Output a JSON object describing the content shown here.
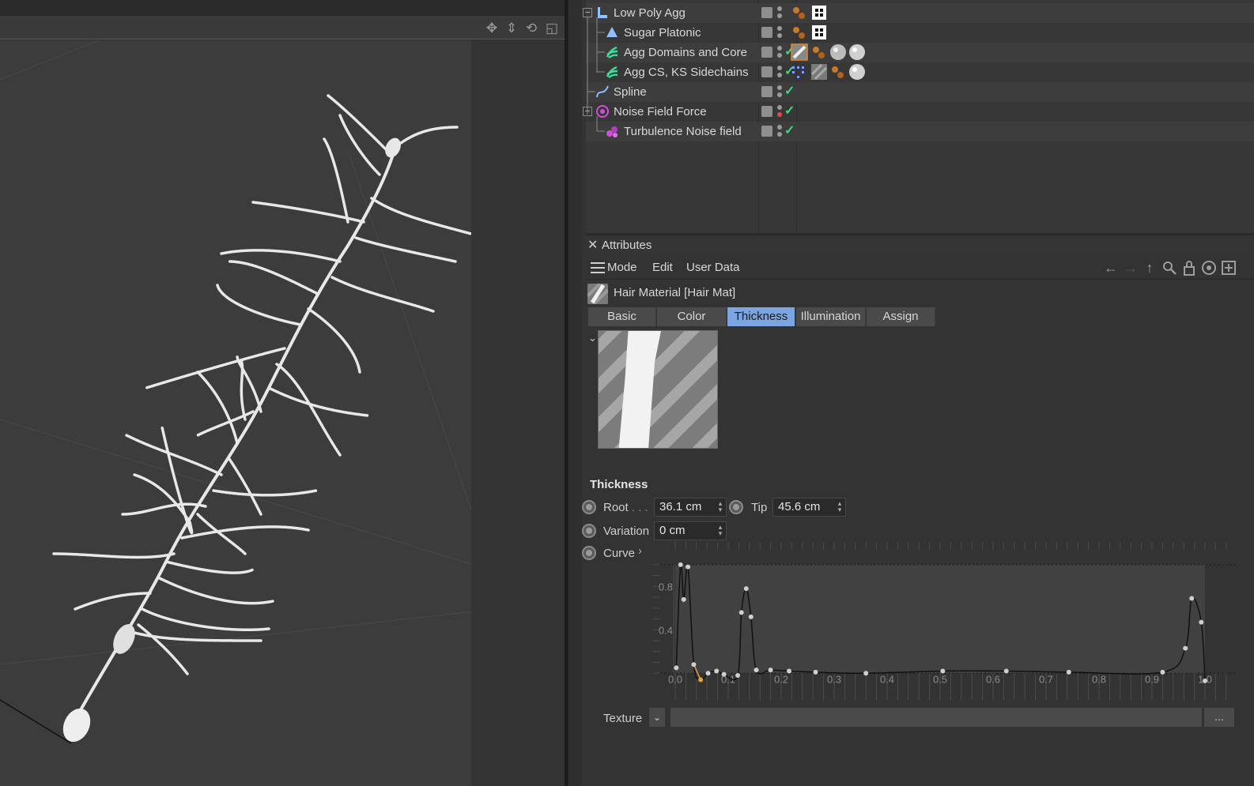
{
  "object_manager": {
    "objects": [
      {
        "name": "Low Poly Agg",
        "icon": "null-object-icon",
        "expander": "−"
      },
      {
        "name": "Sugar Platonic",
        "icon": "platonic-icon"
      },
      {
        "name": "Agg Domains and Core",
        "icon": "hair-object-icon"
      },
      {
        "name": "Agg CS, KS Sidechains",
        "icon": "hair-object-icon"
      },
      {
        "name": "Spline",
        "icon": "spline-icon"
      },
      {
        "name": "Noise Field Force",
        "icon": "field-force-icon",
        "expander": "−"
      },
      {
        "name": "Turbulence Noise field",
        "icon": "noise-field-icon"
      }
    ]
  },
  "attributes": {
    "panel_title": "Attributes",
    "close_glyph": "✕",
    "menu": {
      "mode": "Mode",
      "edit": "Edit",
      "user_data": "User Data"
    },
    "material_title": "Hair Material [Hair Mat]",
    "tabs": [
      {
        "label": "Basic",
        "active": false
      },
      {
        "label": "Color",
        "active": false
      },
      {
        "label": "Thickness",
        "active": true
      },
      {
        "label": "Illumination",
        "active": false
      },
      {
        "label": "Assign",
        "active": false
      }
    ],
    "section_title": "Thickness",
    "root": {
      "label": "Root",
      "lead": " . . .",
      "value": "36.1 cm"
    },
    "tip": {
      "label": "Tip",
      "value": "45.6 cm"
    },
    "variation": {
      "label": "Variation",
      "value": "0 cm"
    },
    "curve": {
      "label": "Curve",
      "arrow": "›"
    },
    "texture": {
      "label": "Texture",
      "more": "..."
    }
  },
  "chart_data": {
    "type": "line",
    "title": "",
    "xlabel": "",
    "ylabel": "",
    "xlim": [
      0,
      1
    ],
    "ylim": [
      -0.1,
      1.05
    ],
    "x_ticks": [
      "0.0",
      "0.1",
      "0.2",
      "0.3",
      "0.4",
      "0.5",
      "0.6",
      "0.7",
      "0.8",
      "0.9",
      "1.0"
    ],
    "y_ticks": [
      "0.4",
      "0.8"
    ],
    "series": [
      {
        "x": [
          0.002,
          0.01,
          0.016,
          0.024,
          0.035,
          0.048,
          0.062,
          0.078,
          0.092,
          0.118,
          0.125,
          0.134,
          0.143,
          0.153,
          0.18,
          0.215,
          0.265,
          0.36,
          0.505,
          0.625,
          0.743,
          0.92,
          0.963,
          0.975,
          0.993,
          1.0
        ],
        "y": [
          0.05,
          1.0,
          0.68,
          0.98,
          0.08,
          -0.06,
          0.0,
          0.02,
          -0.01,
          -0.02,
          0.56,
          0.78,
          0.52,
          0.03,
          0.03,
          0.02,
          0.01,
          0.0,
          0.02,
          0.02,
          0.01,
          0.01,
          0.23,
          0.69,
          0.47,
          -0.07
        ]
      }
    ],
    "highlight_segment": [
      4,
      6
    ],
    "grid": true
  }
}
